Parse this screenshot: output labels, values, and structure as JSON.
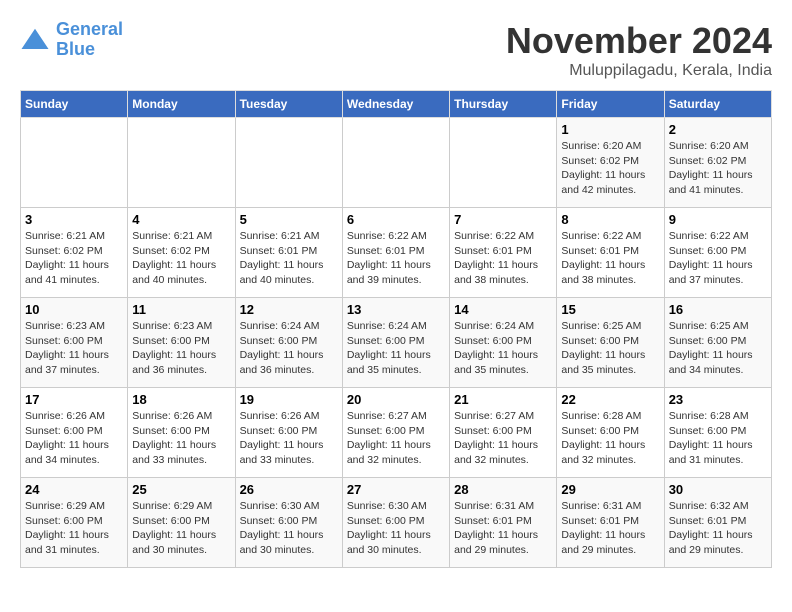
{
  "logo": {
    "line1": "General",
    "line2": "Blue"
  },
  "title": "November 2024",
  "subtitle": "Muluppilagadu, Kerala, India",
  "days_of_week": [
    "Sunday",
    "Monday",
    "Tuesday",
    "Wednesday",
    "Thursday",
    "Friday",
    "Saturday"
  ],
  "weeks": [
    [
      {
        "day": "",
        "detail": ""
      },
      {
        "day": "",
        "detail": ""
      },
      {
        "day": "",
        "detail": ""
      },
      {
        "day": "",
        "detail": ""
      },
      {
        "day": "",
        "detail": ""
      },
      {
        "day": "1",
        "detail": "Sunrise: 6:20 AM\nSunset: 6:02 PM\nDaylight: 11 hours\nand 42 minutes."
      },
      {
        "day": "2",
        "detail": "Sunrise: 6:20 AM\nSunset: 6:02 PM\nDaylight: 11 hours\nand 41 minutes."
      }
    ],
    [
      {
        "day": "3",
        "detail": "Sunrise: 6:21 AM\nSunset: 6:02 PM\nDaylight: 11 hours\nand 41 minutes."
      },
      {
        "day": "4",
        "detail": "Sunrise: 6:21 AM\nSunset: 6:02 PM\nDaylight: 11 hours\nand 40 minutes."
      },
      {
        "day": "5",
        "detail": "Sunrise: 6:21 AM\nSunset: 6:01 PM\nDaylight: 11 hours\nand 40 minutes."
      },
      {
        "day": "6",
        "detail": "Sunrise: 6:22 AM\nSunset: 6:01 PM\nDaylight: 11 hours\nand 39 minutes."
      },
      {
        "day": "7",
        "detail": "Sunrise: 6:22 AM\nSunset: 6:01 PM\nDaylight: 11 hours\nand 38 minutes."
      },
      {
        "day": "8",
        "detail": "Sunrise: 6:22 AM\nSunset: 6:01 PM\nDaylight: 11 hours\nand 38 minutes."
      },
      {
        "day": "9",
        "detail": "Sunrise: 6:22 AM\nSunset: 6:00 PM\nDaylight: 11 hours\nand 37 minutes."
      }
    ],
    [
      {
        "day": "10",
        "detail": "Sunrise: 6:23 AM\nSunset: 6:00 PM\nDaylight: 11 hours\nand 37 minutes."
      },
      {
        "day": "11",
        "detail": "Sunrise: 6:23 AM\nSunset: 6:00 PM\nDaylight: 11 hours\nand 36 minutes."
      },
      {
        "day": "12",
        "detail": "Sunrise: 6:24 AM\nSunset: 6:00 PM\nDaylight: 11 hours\nand 36 minutes."
      },
      {
        "day": "13",
        "detail": "Sunrise: 6:24 AM\nSunset: 6:00 PM\nDaylight: 11 hours\nand 35 minutes."
      },
      {
        "day": "14",
        "detail": "Sunrise: 6:24 AM\nSunset: 6:00 PM\nDaylight: 11 hours\nand 35 minutes."
      },
      {
        "day": "15",
        "detail": "Sunrise: 6:25 AM\nSunset: 6:00 PM\nDaylight: 11 hours\nand 35 minutes."
      },
      {
        "day": "16",
        "detail": "Sunrise: 6:25 AM\nSunset: 6:00 PM\nDaylight: 11 hours\nand 34 minutes."
      }
    ],
    [
      {
        "day": "17",
        "detail": "Sunrise: 6:26 AM\nSunset: 6:00 PM\nDaylight: 11 hours\nand 34 minutes."
      },
      {
        "day": "18",
        "detail": "Sunrise: 6:26 AM\nSunset: 6:00 PM\nDaylight: 11 hours\nand 33 minutes."
      },
      {
        "day": "19",
        "detail": "Sunrise: 6:26 AM\nSunset: 6:00 PM\nDaylight: 11 hours\nand 33 minutes."
      },
      {
        "day": "20",
        "detail": "Sunrise: 6:27 AM\nSunset: 6:00 PM\nDaylight: 11 hours\nand 32 minutes."
      },
      {
        "day": "21",
        "detail": "Sunrise: 6:27 AM\nSunset: 6:00 PM\nDaylight: 11 hours\nand 32 minutes."
      },
      {
        "day": "22",
        "detail": "Sunrise: 6:28 AM\nSunset: 6:00 PM\nDaylight: 11 hours\nand 32 minutes."
      },
      {
        "day": "23",
        "detail": "Sunrise: 6:28 AM\nSunset: 6:00 PM\nDaylight: 11 hours\nand 31 minutes."
      }
    ],
    [
      {
        "day": "24",
        "detail": "Sunrise: 6:29 AM\nSunset: 6:00 PM\nDaylight: 11 hours\nand 31 minutes."
      },
      {
        "day": "25",
        "detail": "Sunrise: 6:29 AM\nSunset: 6:00 PM\nDaylight: 11 hours\nand 30 minutes."
      },
      {
        "day": "26",
        "detail": "Sunrise: 6:30 AM\nSunset: 6:00 PM\nDaylight: 11 hours\nand 30 minutes."
      },
      {
        "day": "27",
        "detail": "Sunrise: 6:30 AM\nSunset: 6:00 PM\nDaylight: 11 hours\nand 30 minutes."
      },
      {
        "day": "28",
        "detail": "Sunrise: 6:31 AM\nSunset: 6:01 PM\nDaylight: 11 hours\nand 29 minutes."
      },
      {
        "day": "29",
        "detail": "Sunrise: 6:31 AM\nSunset: 6:01 PM\nDaylight: 11 hours\nand 29 minutes."
      },
      {
        "day": "30",
        "detail": "Sunrise: 6:32 AM\nSunset: 6:01 PM\nDaylight: 11 hours\nand 29 minutes."
      }
    ]
  ]
}
